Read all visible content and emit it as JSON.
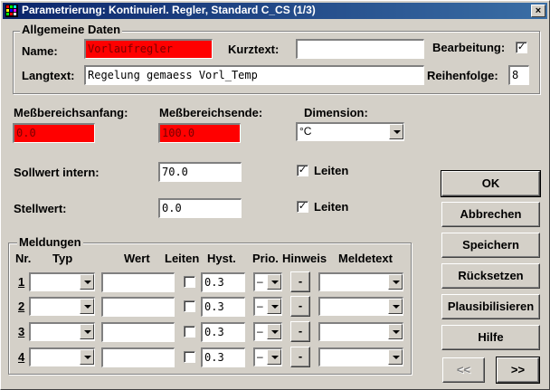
{
  "window": {
    "title": "Parametrierung: Kontinuierl. Regler, Standard  C_CS  (1/3)",
    "close_glyph": "×"
  },
  "allgemeine": {
    "legend": "Allgemeine Daten",
    "name_label": "Name:",
    "name_value": "Vorlaufregler",
    "kurztext_label": "Kurztext:",
    "kurztext_value": "",
    "bearbeitung_label": "Bearbeitung:",
    "bearbeitung_checked": true,
    "langtext_label": "Langtext:",
    "langtext_value": "Regelung gemaess Vorl_Temp",
    "reihenfolge_label": "Reihenfolge:",
    "reihenfolge_value": "8"
  },
  "messbereich": {
    "anfang_label": "Meßbereichsanfang:",
    "anfang_value": "0.0",
    "ende_label": "Meßbereichsende:",
    "ende_value": "100.0",
    "dimension_label": "Dimension:",
    "dimension_value": "°C"
  },
  "sollwert": {
    "label": "Sollwert intern:",
    "value": "70.0",
    "leiten_label": "Leiten",
    "leiten_checked": true
  },
  "stellwert": {
    "label": "Stellwert:",
    "value": "0.0",
    "leiten_label": "Leiten",
    "leiten_checked": true
  },
  "meldungen": {
    "legend": "Meldungen",
    "headers": {
      "nr": "Nr.",
      "typ": "Typ",
      "wert": "Wert",
      "leiten": "Leiten",
      "hyst": "Hyst.",
      "prio": "Prio.",
      "hinweis": "Hinweis",
      "meldetext": "Meldetext"
    },
    "rows": [
      {
        "nr": "1",
        "typ": "",
        "wert": "",
        "leiten": false,
        "hyst": "0.3",
        "prio": "–",
        "hinweis": "-",
        "meldetext": ""
      },
      {
        "nr": "2",
        "typ": "",
        "wert": "",
        "leiten": false,
        "hyst": "0.3",
        "prio": "–",
        "hinweis": "-",
        "meldetext": ""
      },
      {
        "nr": "3",
        "typ": "",
        "wert": "",
        "leiten": false,
        "hyst": "0.3",
        "prio": "–",
        "hinweis": "-",
        "meldetext": ""
      },
      {
        "nr": "4",
        "typ": "",
        "wert": "",
        "leiten": false,
        "hyst": "0.3",
        "prio": "–",
        "hinweis": "-",
        "meldetext": ""
      }
    ]
  },
  "buttons": {
    "ok": "OK",
    "abbrechen": "Abbrechen",
    "speichern": "Speichern",
    "ruecksetzen": "Rücksetzen",
    "plausibilisieren": "Plausibilisieren",
    "hilfe": "Hilfe",
    "prev": "<<",
    "next": ">>"
  },
  "colors": {
    "face": "#d4d0c8",
    "error_field": "#ff0000",
    "title_start": "#0a246a",
    "title_end": "#3a6ea5"
  }
}
